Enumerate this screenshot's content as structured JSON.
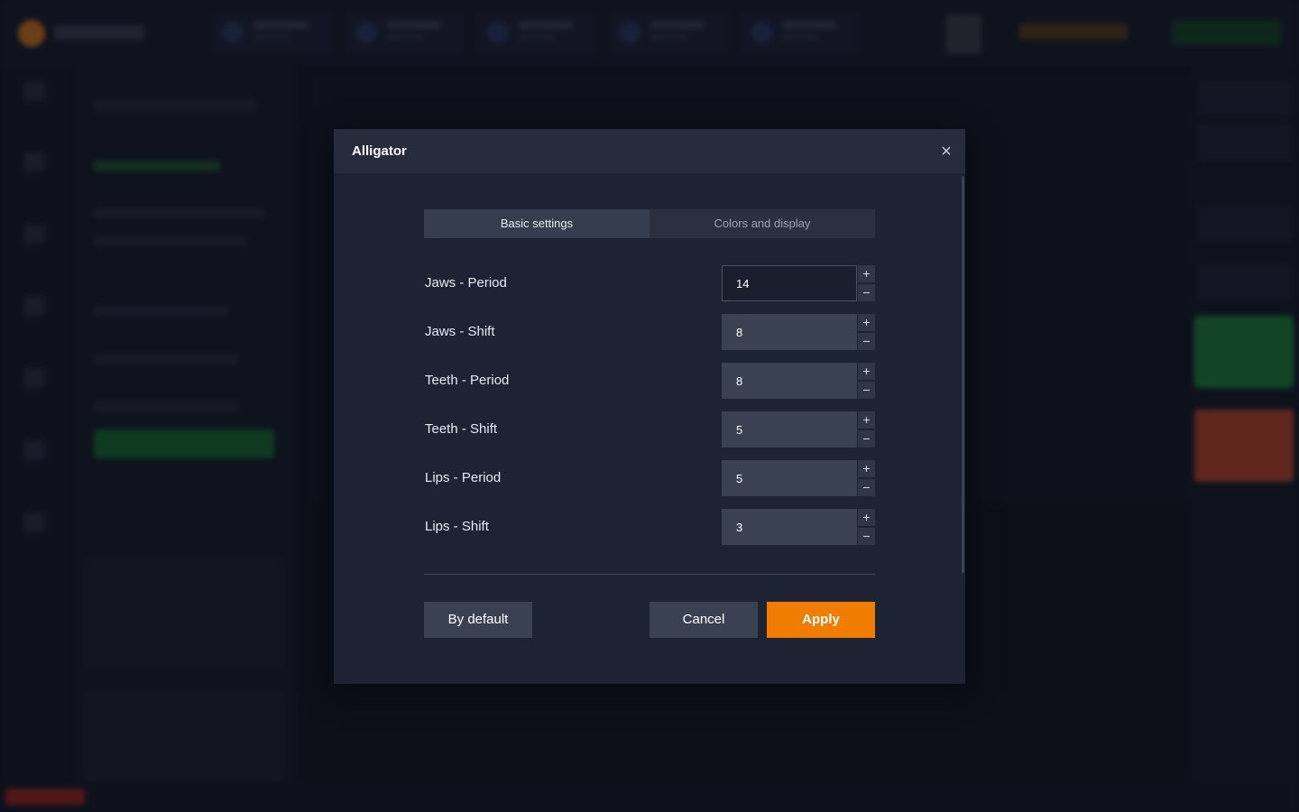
{
  "modal": {
    "title": "Alligator",
    "close_icon": "close-icon"
  },
  "tabs": [
    {
      "label": "Basic settings",
      "active": true
    },
    {
      "label": "Colors and display",
      "active": false
    }
  ],
  "fields": [
    {
      "label": "Jaws - Period",
      "value": "14"
    },
    {
      "label": "Jaws - Shift",
      "value": "8"
    },
    {
      "label": "Teeth - Period",
      "value": "8"
    },
    {
      "label": "Teeth - Shift",
      "value": "5"
    },
    {
      "label": "Lips - Period",
      "value": "5"
    },
    {
      "label": "Lips - Shift",
      "value": "3"
    }
  ],
  "stepper": {
    "plus": "+",
    "minus": "−"
  },
  "buttons": {
    "default_label": "By default",
    "cancel_label": "Cancel",
    "apply_label": "Apply"
  },
  "colors": {
    "accent": "#f07c00",
    "modal_bg": "#1e2333",
    "header_bg": "#262c3c"
  }
}
